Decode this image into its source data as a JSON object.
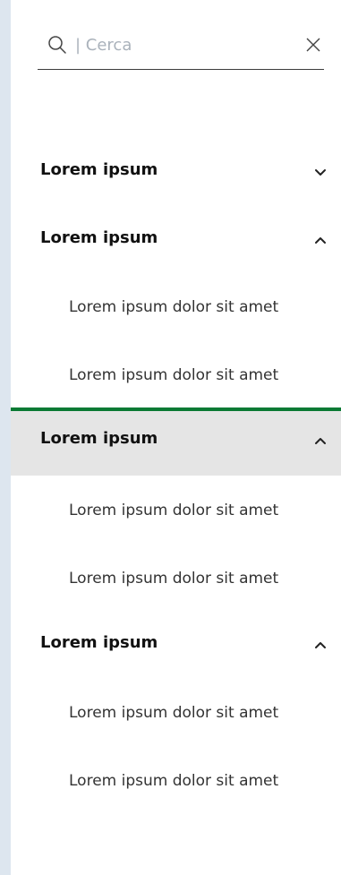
{
  "search": {
    "placeholder": "| Cerca",
    "icon": "search-icon",
    "clear_icon": "close-icon"
  },
  "colors": {
    "page_background": "#dde6ef",
    "panel_background": "#ffffff",
    "active_background": "#e5e5e5",
    "active_accent": "#0a7a34",
    "text_primary": "#111111",
    "text_secondary": "#333333"
  },
  "menu": {
    "sections": [
      {
        "title": "Lorem ipsum",
        "expanded": false,
        "active": false,
        "items": []
      },
      {
        "title": "Lorem ipsum",
        "expanded": true,
        "active": false,
        "items": [
          "Lorem ipsum dolor sit amet",
          "Lorem ipsum dolor sit amet"
        ]
      },
      {
        "title": "Lorem ipsum",
        "expanded": true,
        "active": true,
        "items": [
          "Lorem ipsum dolor sit amet",
          "Lorem ipsum dolor sit amet"
        ]
      },
      {
        "title": "Lorem ipsum",
        "expanded": true,
        "active": false,
        "items": [
          "Lorem ipsum dolor sit amet",
          "Lorem ipsum dolor sit amet"
        ]
      }
    ]
  }
}
